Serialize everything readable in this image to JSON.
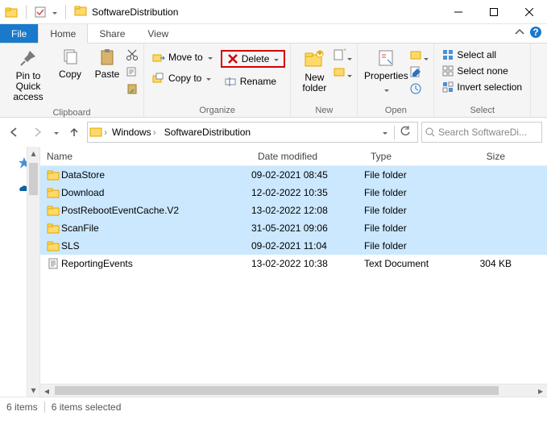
{
  "title": "SoftwareDistribution",
  "tabs": {
    "file": "File",
    "home": "Home",
    "share": "Share",
    "view": "View"
  },
  "ribbon": {
    "clipboard": {
      "label": "Clipboard",
      "pin": "Pin to Quick access",
      "copy": "Copy",
      "paste": "Paste"
    },
    "organize": {
      "label": "Organize",
      "move": "Move to",
      "copyto": "Copy to",
      "delete": "Delete",
      "rename": "Rename"
    },
    "new": {
      "label": "New",
      "newfolder": "New folder"
    },
    "open": {
      "label": "Open",
      "properties": "Properties"
    },
    "select": {
      "label": "Select",
      "all": "Select all",
      "none": "Select none",
      "invert": "Invert selection"
    }
  },
  "breadcrumb": {
    "p0": "Windows",
    "p1": "SoftwareDistribution"
  },
  "search_placeholder": "Search SoftwareDi...",
  "columns": {
    "name": "Name",
    "date": "Date modified",
    "type": "Type",
    "size": "Size"
  },
  "items": [
    {
      "name": "DataStore",
      "date": "09-02-2021 08:45",
      "type": "File folder",
      "size": "",
      "selected": true,
      "kind": "folder"
    },
    {
      "name": "Download",
      "date": "12-02-2022 10:35",
      "type": "File folder",
      "size": "",
      "selected": true,
      "kind": "folder"
    },
    {
      "name": "PostRebootEventCache.V2",
      "date": "13-02-2022 12:08",
      "type": "File folder",
      "size": "",
      "selected": true,
      "kind": "folder"
    },
    {
      "name": "ScanFile",
      "date": "31-05-2021 09:06",
      "type": "File folder",
      "size": "",
      "selected": true,
      "kind": "folder"
    },
    {
      "name": "SLS",
      "date": "09-02-2021 11:04",
      "type": "File folder",
      "size": "",
      "selected": true,
      "kind": "folder"
    },
    {
      "name": "ReportingEvents",
      "date": "13-02-2022 10:38",
      "type": "Text Document",
      "size": "304 KB",
      "selected": false,
      "kind": "txt"
    }
  ],
  "status": {
    "count": "6 items",
    "selected": "6 items selected"
  }
}
